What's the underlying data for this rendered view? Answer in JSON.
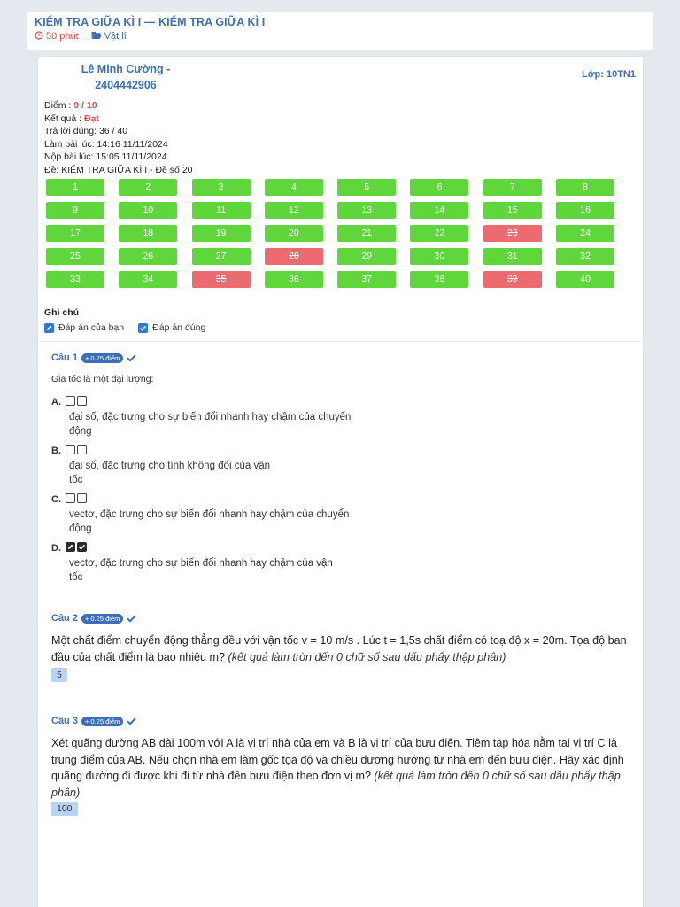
{
  "header": {
    "title": "KIỂM TRA GIỮA KÌ I — KIỂM TRA GIỮA KÌ I",
    "duration": "50 phút",
    "subject": "Vật lí"
  },
  "student": {
    "name_line1": "Lê Minh Cường -",
    "name_line2": "2404442906",
    "class_label": "Lớp: 10TN1"
  },
  "stats": {
    "score_label": "Điểm : ",
    "score_value": "9 / 10",
    "result_label": "Kết quả : ",
    "result_value": "Đạt",
    "correct": "Trả lời đúng: 36 / 40",
    "started": "Làm bài lúc: 14:16 11/11/2024",
    "submitted": "Nộp bài lúc: 15:05 11/11/2024",
    "exam": "Đề: KIỂM TRA GIỮA KÌ I - Đề số 20"
  },
  "questions_grid": [
    {
      "n": "1",
      "ok": true
    },
    {
      "n": "2",
      "ok": true
    },
    {
      "n": "3",
      "ok": true
    },
    {
      "n": "4",
      "ok": true
    },
    {
      "n": "5",
      "ok": true
    },
    {
      "n": "6",
      "ok": true
    },
    {
      "n": "7",
      "ok": true
    },
    {
      "n": "8",
      "ok": true
    },
    {
      "n": "9",
      "ok": true
    },
    {
      "n": "10",
      "ok": true
    },
    {
      "n": "11",
      "ok": true
    },
    {
      "n": "12",
      "ok": true
    },
    {
      "n": "13",
      "ok": true
    },
    {
      "n": "14",
      "ok": true
    },
    {
      "n": "15",
      "ok": true
    },
    {
      "n": "16",
      "ok": true
    },
    {
      "n": "17",
      "ok": true
    },
    {
      "n": "18",
      "ok": true
    },
    {
      "n": "19",
      "ok": true
    },
    {
      "n": "20",
      "ok": true
    },
    {
      "n": "21",
      "ok": true
    },
    {
      "n": "22",
      "ok": true
    },
    {
      "n": "23",
      "ok": false
    },
    {
      "n": "24",
      "ok": true
    },
    {
      "n": "25",
      "ok": true
    },
    {
      "n": "26",
      "ok": true
    },
    {
      "n": "27",
      "ok": true
    },
    {
      "n": "28",
      "ok": false
    },
    {
      "n": "29",
      "ok": true
    },
    {
      "n": "30",
      "ok": true
    },
    {
      "n": "31",
      "ok": true
    },
    {
      "n": "32",
      "ok": true
    },
    {
      "n": "33",
      "ok": true
    },
    {
      "n": "34",
      "ok": true
    },
    {
      "n": "35",
      "ok": false
    },
    {
      "n": "36",
      "ok": true
    },
    {
      "n": "37",
      "ok": true
    },
    {
      "n": "38",
      "ok": true
    },
    {
      "n": "39",
      "ok": false
    },
    {
      "n": "40",
      "ok": true
    }
  ],
  "legend": {
    "title": "Ghi chú",
    "your_answer": "Đáp án của bạn",
    "correct_answer": "Đáp án đúng"
  },
  "q1": {
    "label": "Câu 1",
    "points": "+ 0.25 điểm",
    "text": "Gia tốc là một đại lượng:",
    "options": [
      {
        "letter": "A.",
        "line1": "đại số, đặc trưng cho sự biến đổi nhanh hay chậm của chuyển",
        "line2": "động"
      },
      {
        "letter": "B.",
        "line1": "đại số, đặc trưng cho tính không đổi của vận",
        "line2": "tốc"
      },
      {
        "letter": "C.",
        "line1": "vectơ, đặc trưng cho sự biến đổi nhanh hay chậm của chuyển",
        "line2": "động"
      },
      {
        "letter": "D.",
        "line1": "vectơ, đặc trưng cho sự biến đổi nhanh hay chậm của vận",
        "line2": "tốc"
      }
    ]
  },
  "q2": {
    "label": "Câu 2",
    "points": "+ 0.25 điểm",
    "text": "Một chất điểm chuyển động thẳng đều với vận tốc v = 10 m/s . Lúc t = 1,5s chất điểm có toạ độ x = 20m. Tọa độ ban đầu của chất điểm là bao nhiêu m? ",
    "hint": "(kết quả làm tròn đến 0 chữ số sau dấu phẩy thập phân)",
    "answer": "5"
  },
  "q3": {
    "label": "Câu 3",
    "points": "+ 0.25 điểm",
    "text": "Xét quãng đường AB dài 100m với A là vị trí nhà của em và B là vị trí của bưu điện. Tiệm tạp hóa nằm tại vị trí C là trung điểm của AB. Nếu chọn nhà em làm gốc tọa độ và chiều dương hướng từ nhà em đến bưu điện. Hãy xác định quãng đường đi được khi đi từ nhà đến bưu điện theo đơn vị m? ",
    "hint": "(kết quả làm tròn đến 0 chữ số sau dấu phẩy thập phân)",
    "answer": "100"
  },
  "colors": {
    "accent": "#3d6fb8",
    "correct": "#5ed63c",
    "wrong": "#ec6b70",
    "danger": "#e24b4b"
  }
}
